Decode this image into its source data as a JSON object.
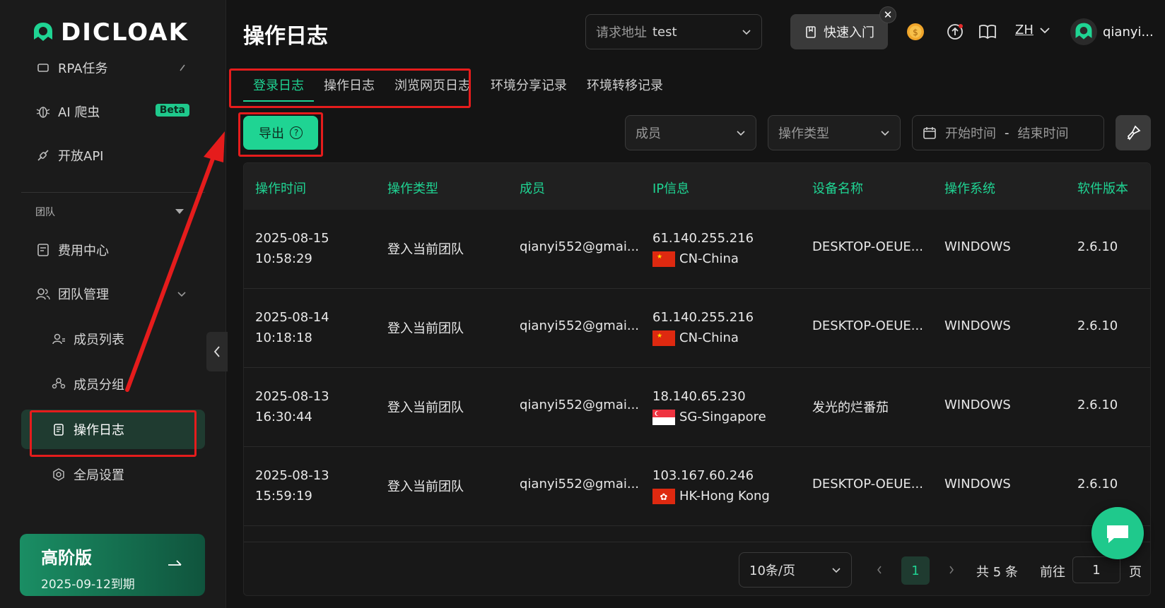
{
  "app": {
    "brand": "DICLOAK",
    "page_title": "操作日志"
  },
  "sidebar": {
    "items_top": [
      {
        "label": "RPA任务",
        "icon": "rpa-icon"
      },
      {
        "label": "AI 爬虫",
        "icon": "bug-icon",
        "badge": "Beta"
      },
      {
        "label": "开放API",
        "icon": "api-icon"
      }
    ],
    "section_label": "团队",
    "items": [
      {
        "label": "费用中心",
        "icon": "billing-icon"
      },
      {
        "label": "团队管理",
        "icon": "team-icon"
      },
      {
        "label": "成员列表",
        "icon": "member-list-icon"
      },
      {
        "label": "成员分组",
        "icon": "member-group-icon"
      },
      {
        "label": "操作日志",
        "icon": "log-icon",
        "active": true
      },
      {
        "label": "全局设置",
        "icon": "settings-icon"
      }
    ],
    "plan": {
      "title": "高阶版",
      "expiry": "2025-09-12到期"
    }
  },
  "header": {
    "request_label": "请求地址",
    "request_value": "test",
    "quick_start": "快速入门",
    "language": "ZH",
    "username": "qianyi..."
  },
  "tabs": [
    "登录日志",
    "操作日志",
    "浏览网页日志",
    "环境分享记录",
    "环境转移记录"
  ],
  "toolbar": {
    "export_label": "导出",
    "member_placeholder": "成员",
    "op_type_placeholder": "操作类型",
    "start_placeholder": "开始时间",
    "range_sep": "-",
    "end_placeholder": "结束时间"
  },
  "table": {
    "headers": [
      "操作时间",
      "操作类型",
      "成员",
      "IP信息",
      "设备名称",
      "操作系统",
      "软件版本"
    ],
    "rows": [
      {
        "date": "2025-08-15",
        "time": "10:58:29",
        "type": "登入当前团队",
        "member": "qianyi552@gmai...",
        "ip": "61.140.255.216",
        "location": "CN-China",
        "flag": "cn",
        "device": "DESKTOP-OEUE...",
        "os": "WINDOWS",
        "version": "2.6.10"
      },
      {
        "date": "2025-08-14",
        "time": "10:18:18",
        "type": "登入当前团队",
        "member": "qianyi552@gmai...",
        "ip": "61.140.255.216",
        "location": "CN-China",
        "flag": "cn",
        "device": "DESKTOP-OEUE...",
        "os": "WINDOWS",
        "version": "2.6.10"
      },
      {
        "date": "2025-08-13",
        "time": "16:30:44",
        "type": "登入当前团队",
        "member": "qianyi552@gmai...",
        "ip": "18.140.65.230",
        "location": "SG-Singapore",
        "flag": "sg",
        "device": "发光的烂番茄",
        "os": "WINDOWS",
        "version": "2.6.10"
      },
      {
        "date": "2025-08-13",
        "time": "15:59:19",
        "type": "登入当前团队",
        "member": "qianyi552@gmai...",
        "ip": "103.167.60.246",
        "location": "HK-Hong Kong",
        "flag": "hk",
        "device": "DESKTOP-OEUE...",
        "os": "WINDOWS",
        "version": "2.6.10"
      }
    ]
  },
  "pagination": {
    "page_size": "10条/页",
    "current_page": "1",
    "total": "共 5 条",
    "goto_label": "前往",
    "goto_value": "1",
    "page_suffix": "页"
  },
  "colors": {
    "accent": "#1fd493",
    "annotation": "#e51c1c",
    "background": "#141414"
  }
}
